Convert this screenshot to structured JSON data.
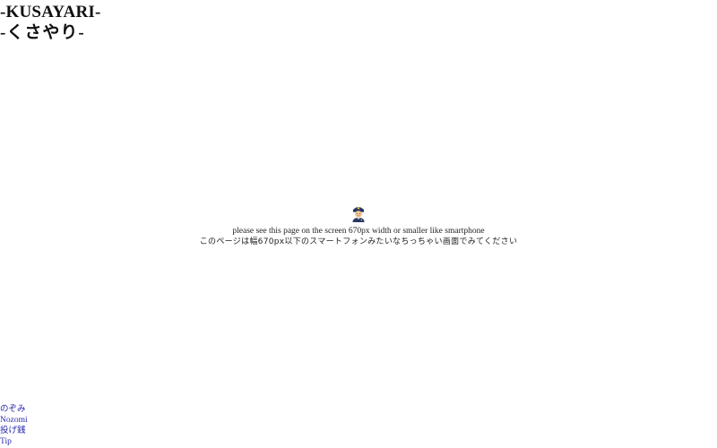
{
  "header": {
    "title_en": "-KUSAYARI-",
    "title_jp": "-くさやり-"
  },
  "notice": {
    "icon": "police-officer-icon",
    "message_en": "please see this page on the screen 670px width or smaller like smartphone",
    "message_jp": "このページは幅670px以下のスマートフォンみたいなちっちゃい画面でみてください"
  },
  "footer_links": [
    {
      "label": "のぞみ"
    },
    {
      "label": "Nozomi"
    },
    {
      "label": "投げ銭"
    },
    {
      "label": "Tip"
    }
  ],
  "colors": {
    "link": "#2a2ab0",
    "text": "#222222",
    "background": "#ffffff"
  }
}
